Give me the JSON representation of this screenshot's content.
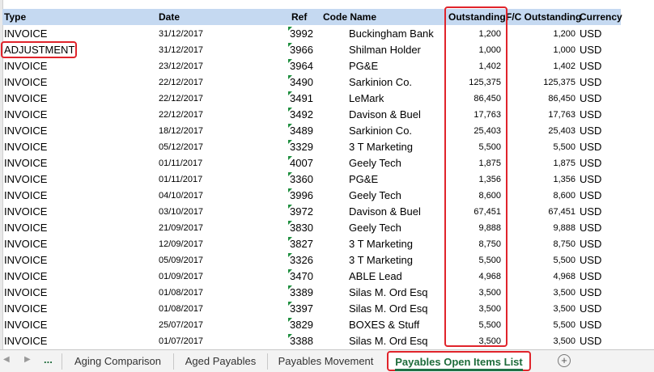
{
  "columns": {
    "type": "Type",
    "date": "Date",
    "ref": "Ref",
    "code_name": "Code Name",
    "outstanding": "Outstanding",
    "fc_outstanding": "F/C Outstanding",
    "currency": "Currency"
  },
  "rows": [
    {
      "type": "INVOICE",
      "date": "31/12/2017",
      "ref": "3992",
      "name": "Buckingham Bank",
      "outstanding": "1,200",
      "fc": "1,200",
      "currency": "USD"
    },
    {
      "type": "ADJUSTMENT",
      "date": "31/12/2017",
      "ref": "3966",
      "name": "Shilman Holder",
      "outstanding": "1,000",
      "fc": "1,000",
      "currency": "USD"
    },
    {
      "type": "INVOICE",
      "date": "23/12/2017",
      "ref": "3964",
      "name": "PG&E",
      "outstanding": "1,402",
      "fc": "1,402",
      "currency": "USD"
    },
    {
      "type": "INVOICE",
      "date": "22/12/2017",
      "ref": "3490",
      "name": "Sarkinion Co.",
      "outstanding": "125,375",
      "fc": "125,375",
      "currency": "USD"
    },
    {
      "type": "INVOICE",
      "date": "22/12/2017",
      "ref": "3491",
      "name": "LeMark",
      "outstanding": "86,450",
      "fc": "86,450",
      "currency": "USD"
    },
    {
      "type": "INVOICE",
      "date": "22/12/2017",
      "ref": "3492",
      "name": "Davison & Buel",
      "outstanding": "17,763",
      "fc": "17,763",
      "currency": "USD"
    },
    {
      "type": "INVOICE",
      "date": "18/12/2017",
      "ref": "3489",
      "name": "Sarkinion Co.",
      "outstanding": "25,403",
      "fc": "25,403",
      "currency": "USD"
    },
    {
      "type": "INVOICE",
      "date": "05/12/2017",
      "ref": "3329",
      "name": "3 T Marketing",
      "outstanding": "5,500",
      "fc": "5,500",
      "currency": "USD"
    },
    {
      "type": "INVOICE",
      "date": "01/11/2017",
      "ref": "4007",
      "name": "Geely Tech",
      "outstanding": "1,875",
      "fc": "1,875",
      "currency": "USD"
    },
    {
      "type": "INVOICE",
      "date": "01/11/2017",
      "ref": "3360",
      "name": "PG&E",
      "outstanding": "1,356",
      "fc": "1,356",
      "currency": "USD"
    },
    {
      "type": "INVOICE",
      "date": "04/10/2017",
      "ref": "3996",
      "name": "Geely Tech",
      "outstanding": "8,600",
      "fc": "8,600",
      "currency": "USD"
    },
    {
      "type": "INVOICE",
      "date": "03/10/2017",
      "ref": "3972",
      "name": "Davison & Buel",
      "outstanding": "67,451",
      "fc": "67,451",
      "currency": "USD"
    },
    {
      "type": "INVOICE",
      "date": "21/09/2017",
      "ref": "3830",
      "name": "Geely Tech",
      "outstanding": "9,888",
      "fc": "9,888",
      "currency": "USD"
    },
    {
      "type": "INVOICE",
      "date": "12/09/2017",
      "ref": "3827",
      "name": "3 T Marketing",
      "outstanding": "8,750",
      "fc": "8,750",
      "currency": "USD"
    },
    {
      "type": "INVOICE",
      "date": "05/09/2017",
      "ref": "3326",
      "name": "3 T Marketing",
      "outstanding": "5,500",
      "fc": "5,500",
      "currency": "USD"
    },
    {
      "type": "INVOICE",
      "date": "01/09/2017",
      "ref": "3470",
      "name": "ABLE Lead",
      "outstanding": "4,968",
      "fc": "4,968",
      "currency": "USD"
    },
    {
      "type": "INVOICE",
      "date": "01/08/2017",
      "ref": "3389",
      "name": "Silas M. Ord Esq",
      "outstanding": "3,500",
      "fc": "3,500",
      "currency": "USD"
    },
    {
      "type": "INVOICE",
      "date": "01/08/2017",
      "ref": "3397",
      "name": "Silas M. Ord Esq",
      "outstanding": "3,500",
      "fc": "3,500",
      "currency": "USD"
    },
    {
      "type": "INVOICE",
      "date": "25/07/2017",
      "ref": "3829",
      "name": "BOXES & Stuff",
      "outstanding": "5,500",
      "fc": "5,500",
      "currency": "USD"
    },
    {
      "type": "INVOICE",
      "date": "01/07/2017",
      "ref": "3388",
      "name": "Silas M. Ord Esq",
      "outstanding": "3,500",
      "fc": "3,500",
      "currency": "USD"
    }
  ],
  "tabs": {
    "ellipsis": "...",
    "items": [
      "Aging Comparison",
      "Aged Payables",
      "Payables Movement",
      "Payables Open Items List"
    ],
    "active_index": 3,
    "add_label": "+"
  },
  "colors": {
    "header_fill": "#c5d9f1",
    "highlight": "#e0242b",
    "comment_marker": "#1e8e3e",
    "active_tab_text": "#1e6b3a"
  }
}
